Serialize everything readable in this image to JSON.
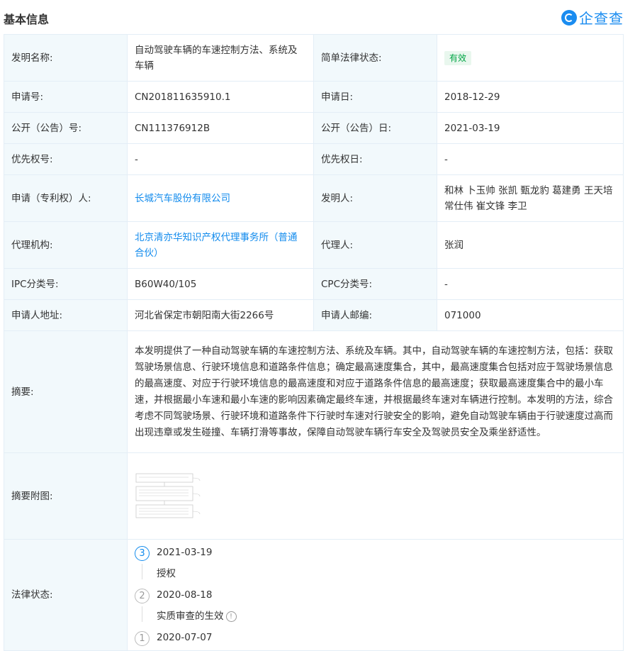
{
  "header": {
    "title": "基本信息",
    "logo_text": "企查查"
  },
  "rows": {
    "invention_name": {
      "label": "发明名称:",
      "value": "自动驾驶车辆的车速控制方法、系统及车辆",
      "label2": "简单法律状态:",
      "status_badge": "有效"
    },
    "application_no": {
      "label": "申请号:",
      "value": "CN201811635910.1",
      "label2": "申请日:",
      "value2": "2018-12-29"
    },
    "publication_no": {
      "label": "公开（公告）号:",
      "value": "CN111376912B",
      "label2": "公开（公告）日:",
      "value2": "2021-03-19"
    },
    "priority_no": {
      "label": "优先权号:",
      "value": "-",
      "label2": "优先权日:",
      "value2": "-"
    },
    "applicant": {
      "label": "申请（专利权）人:",
      "value": "长城汽车股份有限公司",
      "label2": "发明人:",
      "value2": "和林 卜玉帅 张凯 甄龙豹 葛建勇 王天培 常仕伟 崔文锋 李卫"
    },
    "agency": {
      "label": "代理机构:",
      "value": "北京清亦华知识产权代理事务所（普通合伙）",
      "label2": "代理人:",
      "value2": "张润"
    },
    "ipc": {
      "label": "IPC分类号:",
      "value": "B60W40/105",
      "label2": "CPC分类号:",
      "value2": "-"
    },
    "address": {
      "label": "申请人地址:",
      "value": "河北省保定市朝阳南大街2266号",
      "label2": "申请人邮编:",
      "value2": "071000"
    },
    "abstract": {
      "label": "摘要:",
      "value": "本发明提供了一种自动驾驶车辆的车速控制方法、系统及车辆。其中，自动驾驶车辆的车速控制方法，包括：获取驾驶场景信息、行驶环境信息和道路条件信息；确定最高速度集合，其中，最高速度集合包括对应于驾驶场景信息的最高速度、对应于行驶环境信息的最高速度和对应于道路条件信息的最高速度；获取最高速度集合中的最小车速，并根据最小车速和最小车速的影响因素确定最终车速，并根据最终车速对车辆进行控制。本发明的方法，综合考虑不同驾驶场景、行驶环境和道路条件下行驶时车速对行驶安全的影响，避免自动驾驶车辆由于行驶速度过高而出现违章或发生碰撞、车辆打滑等事故，保障自动驾驶车辆行车安全及驾驶员安全及乘坐舒适性。"
    },
    "abstract_figure": {
      "label": "摘要附图:"
    },
    "legal_status": {
      "label": "法律状态:",
      "events": [
        {
          "num": "3",
          "date": "2021-03-19",
          "desc": "授权"
        },
        {
          "num": "2",
          "date": "2020-08-18",
          "desc": "实质审查的生效"
        },
        {
          "num": "1",
          "date": "2020-07-07"
        }
      ]
    }
  }
}
